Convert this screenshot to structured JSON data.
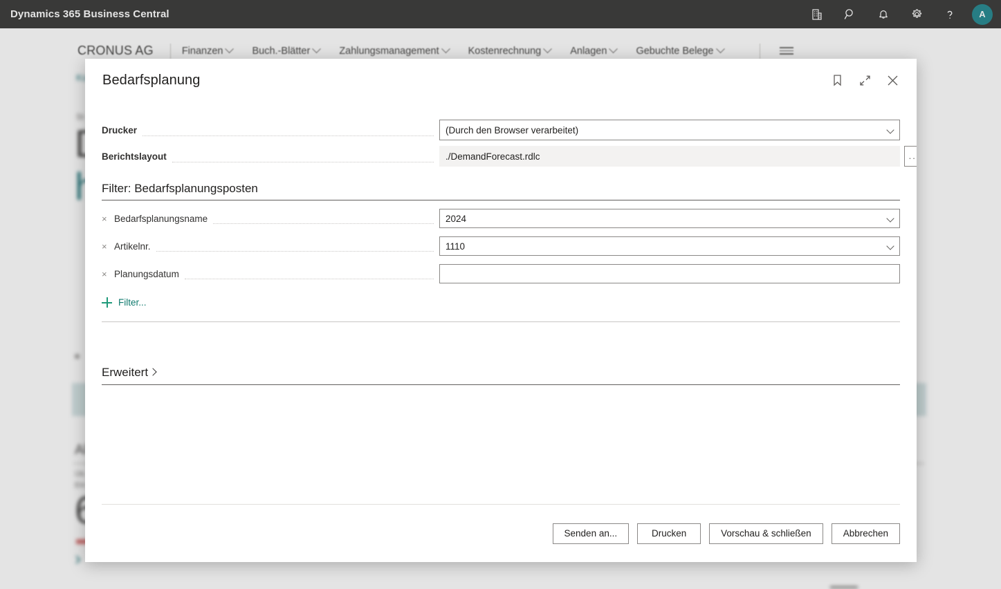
{
  "topbar": {
    "title": "Dynamics 365 Business Central",
    "icons": [
      "company-icon",
      "search-icon",
      "notifications-icon",
      "settings-icon",
      "help-icon"
    ],
    "avatar_initial": "A"
  },
  "nav": {
    "company": "CRONUS AG",
    "items": [
      {
        "label": "Finanzen",
        "has_chevron": true
      },
      {
        "label": "Buch.-Blätter",
        "has_chevron": true
      },
      {
        "label": "Zahlungsmanagement",
        "has_chevron": true
      },
      {
        "label": "Kostenrechnung",
        "has_chevron": true
      },
      {
        "label": "Anlagen",
        "has_chevron": true
      },
      {
        "label": "Gebuchte Belege",
        "has_chevron": true
      }
    ]
  },
  "background": {
    "breadcrumb": "Ko",
    "status_label": "St",
    "big_number_1": "D",
    "big_number_2": "h",
    "big_number_3": "6",
    "section_title": "Al",
    "sub_line_1": "Üb",
    "sub_line_2": "Ein",
    "big_number_4": "6",
    "arrow": "›",
    "arrow_top_right": "↗"
  },
  "dialog": {
    "title": "Bedarfsplanung",
    "header_actions": [
      {
        "name": "bookmark-icon",
        "label": "Lesezeichen"
      },
      {
        "name": "shrink-icon",
        "label": "Verkleinern"
      },
      {
        "name": "close-icon",
        "label": "Schließen"
      }
    ],
    "fields": [
      {
        "label": "Drucker",
        "value": "(Durch den Browser verarbeitet)",
        "type": "dropdown",
        "readonly": false
      },
      {
        "label": "Berichtslayout",
        "value": "./DemandForecast.rdlc",
        "type": "assist",
        "readonly": true,
        "assist_label": "..."
      }
    ],
    "filter_section": {
      "heading": "Filter: Bedarfsplanungsposten",
      "rows": [
        {
          "label": "Bedarfsplanungsname",
          "value": "2024",
          "type": "dropdown",
          "remove_label": "×"
        },
        {
          "label": "Artikelnr.",
          "value": "1110",
          "type": "dropdown",
          "remove_label": "×"
        },
        {
          "label": "Planungsdatum",
          "value": "",
          "type": "text",
          "remove_label": "×"
        }
      ],
      "add_filter_label": "Filter..."
    },
    "advanced": {
      "label": "Erweitert",
      "expanded": false
    },
    "footer_buttons": [
      {
        "label": "Senden an...",
        "name": "send-to-button"
      },
      {
        "label": "Drucken",
        "name": "print-button"
      },
      {
        "label": "Vorschau & schließen",
        "name": "preview-and-close-button"
      },
      {
        "label": "Abbrechen",
        "name": "cancel-button"
      }
    ]
  },
  "colors": {
    "topbar_bg": "#252423",
    "accent_teal": "#0d7c84",
    "link_green": "#0f7a6e",
    "tile_teal": "#cfe0e1",
    "red_bar": "#d2605f"
  }
}
